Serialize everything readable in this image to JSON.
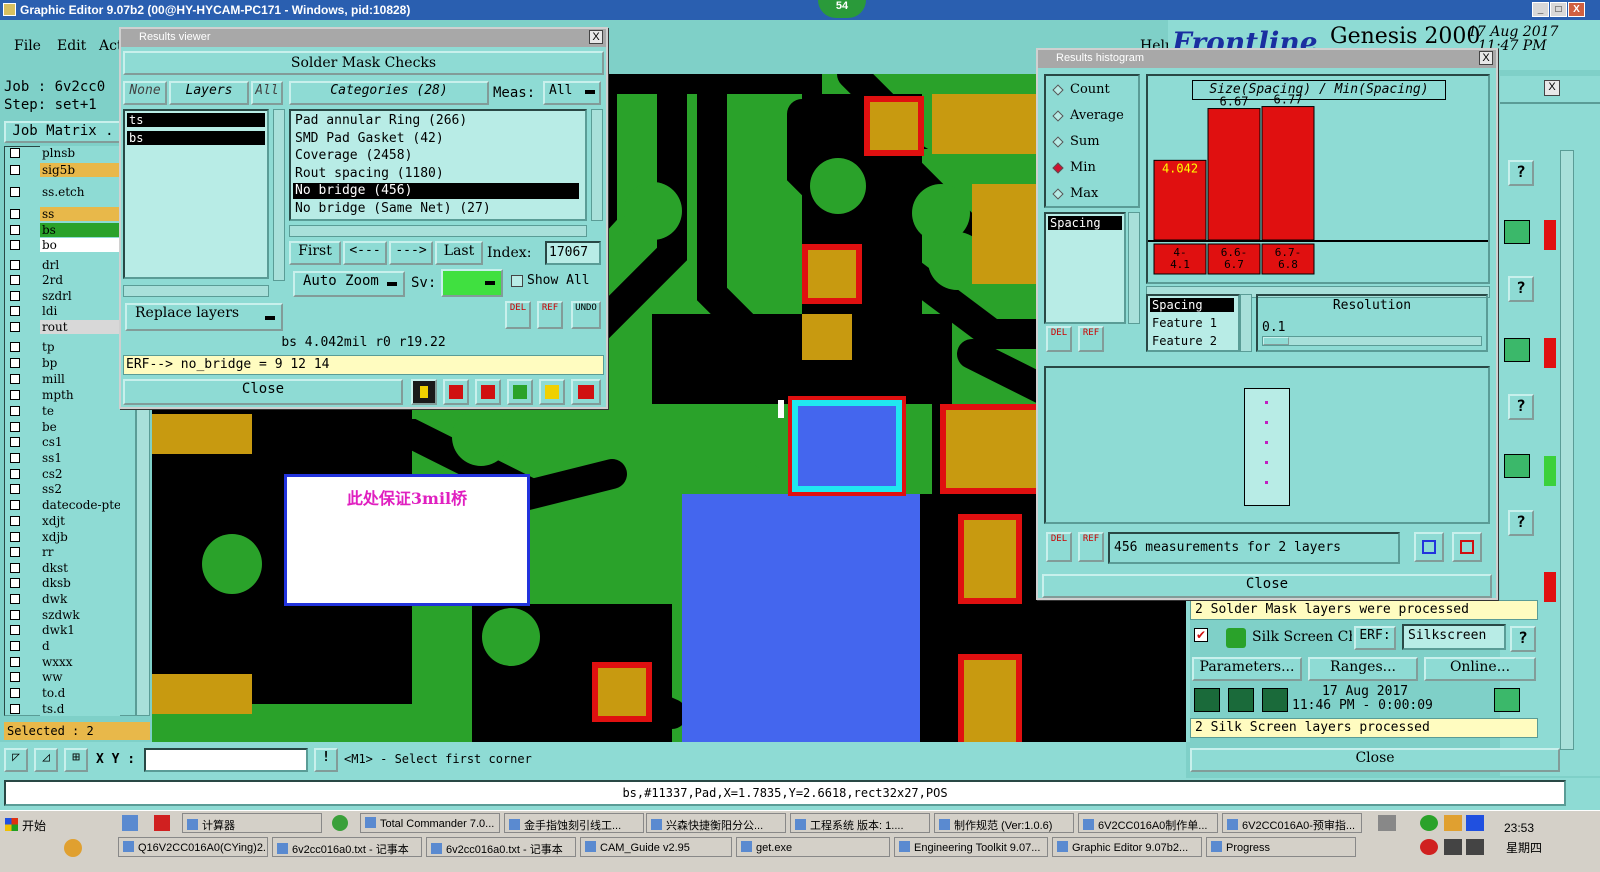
{
  "app": {
    "title": "Graphic Editor 9.07b2 (00@HY-HYCAM-PC171 - Windows, pid:10828)",
    "badge": "54"
  },
  "menu": {
    "file": "File",
    "edit": "Edit",
    "act": "Act",
    "help": "Help"
  },
  "job": {
    "job": "Job :  6v2cc0",
    "step": "Step: set+1",
    "matrix": "Job Matrix ."
  },
  "layers": [
    {
      "name": "plnsb",
      "color": "#8edbd4"
    },
    {
      "name": "sig5b",
      "color": "#e8b84a"
    },
    {
      "name": "ss.etch",
      "color": "#8edbd4"
    },
    {
      "name": "ss",
      "color": "#e8b84a"
    },
    {
      "name": "bs",
      "color": "#2aa22a"
    },
    {
      "name": "bo",
      "color": "#ffffff"
    },
    {
      "name": "drl",
      "color": "#8edbd4"
    },
    {
      "name": "2rd",
      "color": "#8edbd4"
    },
    {
      "name": "szdrl",
      "color": "#8edbd4"
    },
    {
      "name": "ldi",
      "color": "#8edbd4"
    },
    {
      "name": "rout",
      "color": "#d8d8d8"
    },
    {
      "name": "tp",
      "color": "#8edbd4"
    },
    {
      "name": "bp",
      "color": "#8edbd4"
    },
    {
      "name": "mill",
      "color": "#8edbd4"
    },
    {
      "name": "mpth",
      "color": "#8edbd4"
    },
    {
      "name": "te",
      "color": "#8edbd4"
    },
    {
      "name": "be",
      "color": "#8edbd4"
    },
    {
      "name": "cs1",
      "color": "#8edbd4"
    },
    {
      "name": "ss1",
      "color": "#8edbd4"
    },
    {
      "name": "cs2",
      "color": "#8edbd4"
    },
    {
      "name": "ss2",
      "color": "#8edbd4"
    },
    {
      "name": "datecode-pte",
      "color": "#8edbd4"
    },
    {
      "name": "xdjt",
      "color": "#8edbd4"
    },
    {
      "name": "xdjb",
      "color": "#8edbd4"
    },
    {
      "name": "rr",
      "color": "#8edbd4"
    },
    {
      "name": "dkst",
      "color": "#8edbd4"
    },
    {
      "name": "dksb",
      "color": "#8edbd4"
    },
    {
      "name": "dwk",
      "color": "#8edbd4"
    },
    {
      "name": "szdwk",
      "color": "#8edbd4"
    },
    {
      "name": "dwk1",
      "color": "#8edbd4"
    },
    {
      "name": "d",
      "color": "#8edbd4"
    },
    {
      "name": "wxxx",
      "color": "#8edbd4"
    },
    {
      "name": "ww",
      "color": "#8edbd4"
    },
    {
      "name": "to.d",
      "color": "#8edbd4"
    },
    {
      "name": "ts.d",
      "color": "#8edbd4"
    }
  ],
  "selected": "Selected : 2",
  "results_viewer": {
    "title": "Results viewer",
    "header": "Solder Mask Checks",
    "none": "None",
    "layers": "Layers",
    "all": "All",
    "categories_label": "Categories (28)",
    "meas_label": "Meas:",
    "meas_value": "All",
    "layer_items": [
      "ts",
      "bs"
    ],
    "categories": [
      "Pad annular Ring (266)",
      "SMD Pad Gasket (42)",
      "Coverage (2458)",
      "Rout spacing (1180)",
      "No bridge (456)",
      "No bridge (Same Net) (27)"
    ],
    "first": "First",
    "prev": "<---",
    "next": "--->",
    "last": "Last",
    "index_label": "Index:",
    "index_value": "17067",
    "auto_zoom": "Auto Zoom",
    "sv": "Sv:",
    "show_all": "Show All",
    "replace_layers": "Replace layers",
    "status": "bs 4.042mil  r0  r19.22",
    "erf": "ERF--> no_bridge = 9 12 14",
    "close": "Close",
    "del": "DEL",
    "ref": "REF",
    "undo": "UNDO"
  },
  "histogram": {
    "title": "Results histogram",
    "options": [
      "Count",
      "Average",
      "Sum",
      "Min",
      "Max"
    ],
    "selected_option": "Min",
    "chart_title": "Size(Spacing) / Min(Spacing)",
    "list_items": [
      "Spacing"
    ],
    "sub_items": [
      "Spacing",
      "Feature 1",
      "Feature 2"
    ],
    "resolution_label": "Resolution",
    "resolution_value": "0.1",
    "measurements": "456 measurements for 2 layers",
    "close": "Close",
    "del": "DEL",
    "ref": "REF"
  },
  "chart_data": {
    "type": "bar",
    "title": "Size(Spacing) / Min(Spacing)",
    "categories": [
      "4-4.1",
      "6.6-6.7",
      "6.7-6.8"
    ],
    "category_labels": [
      [
        "4-",
        "4.1"
      ],
      [
        "6.6-",
        "6.7"
      ],
      [
        "6.7-",
        "6.8"
      ]
    ],
    "values": [
      4.042,
      6.67,
      6.77
    ],
    "value_labels": [
      "4.042",
      "6.67",
      "6.77"
    ],
    "colors": [
      "#e01010"
    ]
  },
  "genesis": {
    "brand": "Frontline",
    "product": "Genesis 2000",
    "date": "17 Aug 2017",
    "time": "11:47 PM"
  },
  "checklist": {
    "solder_msg": "2 Solder Mask layers were processed",
    "silk_label": "Silk Screen Che",
    "erf_label": "ERF:",
    "erf_value": "Silkscreen",
    "parameters": "Parameters...",
    "ranges": "Ranges...",
    "online": "Online...",
    "date": "17 Aug 2017",
    "time": "11:46 PM - 0:00:09",
    "silk_msg": "2 Silk Screen layers processed",
    "close": "Close",
    "help": "?"
  },
  "annotation": "此处保证3mil桥",
  "coord": {
    "xy": "X Y :",
    "value": "",
    "prompt": "<M1> - Select first corner"
  },
  "status_bar": "bs,#11337,Pad,X=1.7835,Y=2.6618,rect32x27,POS",
  "taskbar": {
    "start": "开始",
    "row1": [
      "计算器",
      "Total Commander 7.0...",
      "金手指蚀刻引线工...",
      "兴森快捷衡阳分公...",
      "工程系统  版本: 1....",
      "制作规范 (Ver:1.0.6)",
      "6V2CC016A0制作单...",
      "6V2CC016A0-预审指..."
    ],
    "row2": [
      "Q16V2CC016A0(CYing)2...",
      "6v2cc016a0.txt - 记事本",
      "6v2cc016a0.txt - 记事本",
      "CAM_Guide v2.95",
      "get.exe",
      "Engineering Toolkit 9.07...",
      "Graphic Editor 9.07b2...",
      "Progress"
    ],
    "time": "23:53",
    "day": "星期四"
  }
}
